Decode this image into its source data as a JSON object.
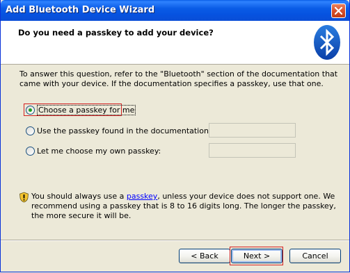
{
  "window": {
    "title": "Add Bluetooth Device Wizard",
    "close_icon": "close-icon"
  },
  "header": {
    "title": "Do you need a passkey to add your device?",
    "logo": "bluetooth-logo"
  },
  "body": {
    "description": "To answer this question, refer to the \"Bluetooth\" section of the documentation that came with your device. If the documentation specifies a passkey, use that one.",
    "options": [
      {
        "label": "Choose a passkey for me",
        "checked": true
      },
      {
        "label": "Use the passkey found in the documentation:",
        "checked": false,
        "value": ""
      },
      {
        "label": "Let me choose my own passkey:",
        "checked": false,
        "value": ""
      }
    ],
    "note": {
      "icon": "shield-warning-icon",
      "prefix": "You should always use a ",
      "link": "passkey",
      "suffix": ", unless your device does not support one. We recommend using a passkey that is 8 to 16 digits long. The longer the passkey, the more secure it will be."
    }
  },
  "buttons": {
    "back": "< Back",
    "next": "Next >",
    "cancel": "Cancel"
  },
  "colors": {
    "title_bar": "#0a5ce6",
    "dialog_bg": "#ece9d8",
    "highlight": "#d21f1f",
    "link": "#0000ff"
  }
}
